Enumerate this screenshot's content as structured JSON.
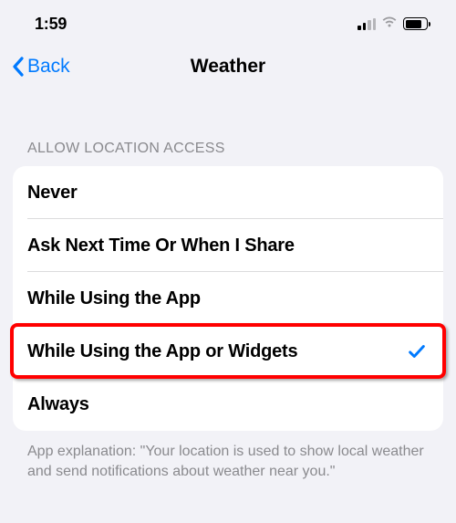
{
  "status_bar": {
    "time": "1:59"
  },
  "nav": {
    "back_label": "Back",
    "title": "Weather"
  },
  "section": {
    "header": "ALLOW LOCATION ACCESS",
    "options": [
      {
        "label": "Never",
        "selected": false
      },
      {
        "label": "Ask Next Time Or When I Share",
        "selected": false
      },
      {
        "label": "While Using the App",
        "selected": false
      },
      {
        "label": "While Using the App or Widgets",
        "selected": true
      },
      {
        "label": "Always",
        "selected": false
      }
    ],
    "footer": "App explanation: \"Your location is used to show local weather and send notifications about weather near you.\""
  },
  "highlight": {
    "option_index": 3
  },
  "colors": {
    "accent": "#007aff",
    "highlight_border": "#ff0000",
    "background": "#f2f2f7"
  }
}
